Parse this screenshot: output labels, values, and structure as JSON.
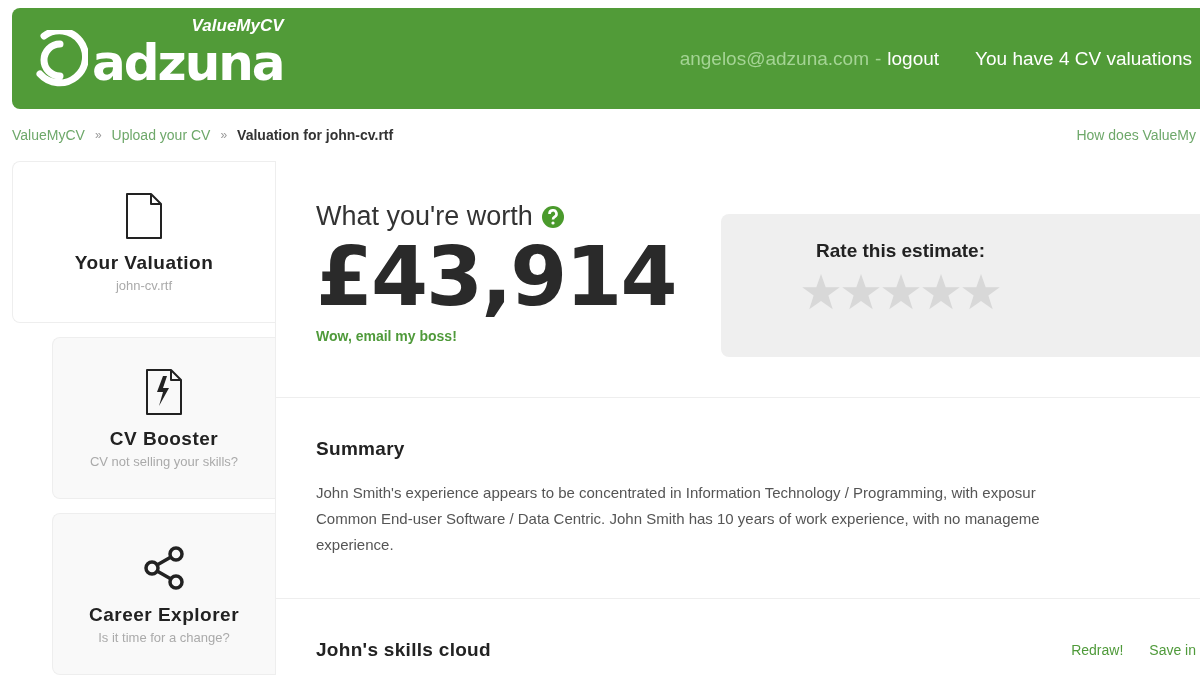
{
  "header": {
    "brand": "adzuna",
    "product": "ValueMyCV",
    "email": "angelos@adzuna.com",
    "separator": "-",
    "logout": "logout",
    "valuations": "You have 4 CV valuations"
  },
  "breadcrumb": {
    "items": [
      {
        "label": "ValueMyCV",
        "current": false
      },
      {
        "label": "Upload your CV",
        "current": false
      },
      {
        "label": "Valuation for john-cv.rtf",
        "current": true
      }
    ],
    "separator": "»",
    "help": "How does ValueMy"
  },
  "sidebar": {
    "items": [
      {
        "kind": "file",
        "title": "Your Valuation",
        "subtitle": "john-cv.rtf",
        "selected": true
      },
      {
        "kind": "boost",
        "title": "CV Booster",
        "subtitle": "CV not selling your skills?",
        "selected": false
      },
      {
        "kind": "share",
        "title": "Career Explorer",
        "subtitle": "Is it time for a change?",
        "selected": false
      }
    ]
  },
  "worth": {
    "title": "What you're worth",
    "amount": "£43,914",
    "link": "Wow, email my boss!"
  },
  "rating": {
    "title": "Rate this estimate:",
    "stars": 0
  },
  "summary": {
    "title": "Summary",
    "lines": [
      "John Smith's experience appears to be concentrated in Information Technology / Programming, with exposur",
      "Common End-user Software / Data Centric. John Smith has 10 years of work experience, with no manageme",
      "experience."
    ]
  },
  "skills": {
    "title": "John's skills cloud",
    "actions": [
      "Redraw!",
      "Save in"
    ]
  }
}
